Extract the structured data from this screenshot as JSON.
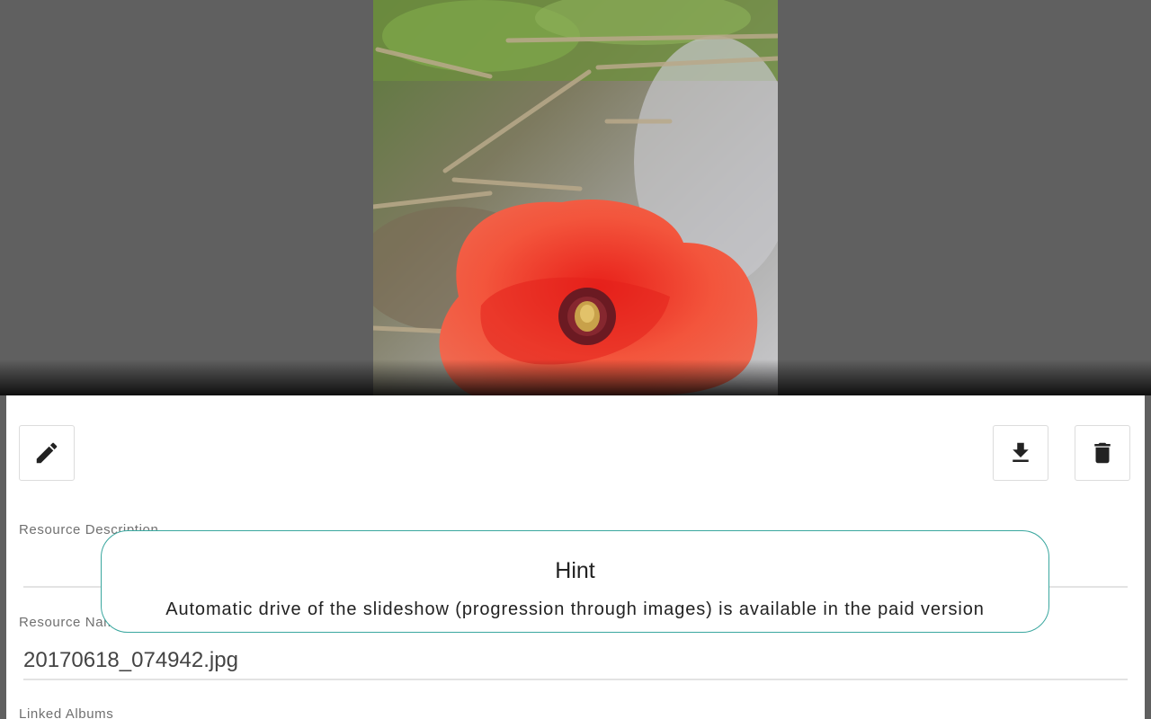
{
  "viewer": {
    "photo_description_icon": "poppy-photo"
  },
  "toolbar": {
    "edit_icon": "pencil-icon",
    "download_icon": "download-icon",
    "delete_icon": "trash-icon"
  },
  "form": {
    "description_label": "Resource Description",
    "description_value": "",
    "name_label": "Resource Name",
    "name_value": "20170618_074942.jpg",
    "albums_label": "Linked Albums"
  },
  "hint": {
    "title": "Hint",
    "message": "Automatic drive of the slideshow (progression through images) is available in the paid version"
  },
  "colors": {
    "viewer_background": "#606060",
    "hint_border": "#3aa79f",
    "panel_background": "#ffffff"
  }
}
